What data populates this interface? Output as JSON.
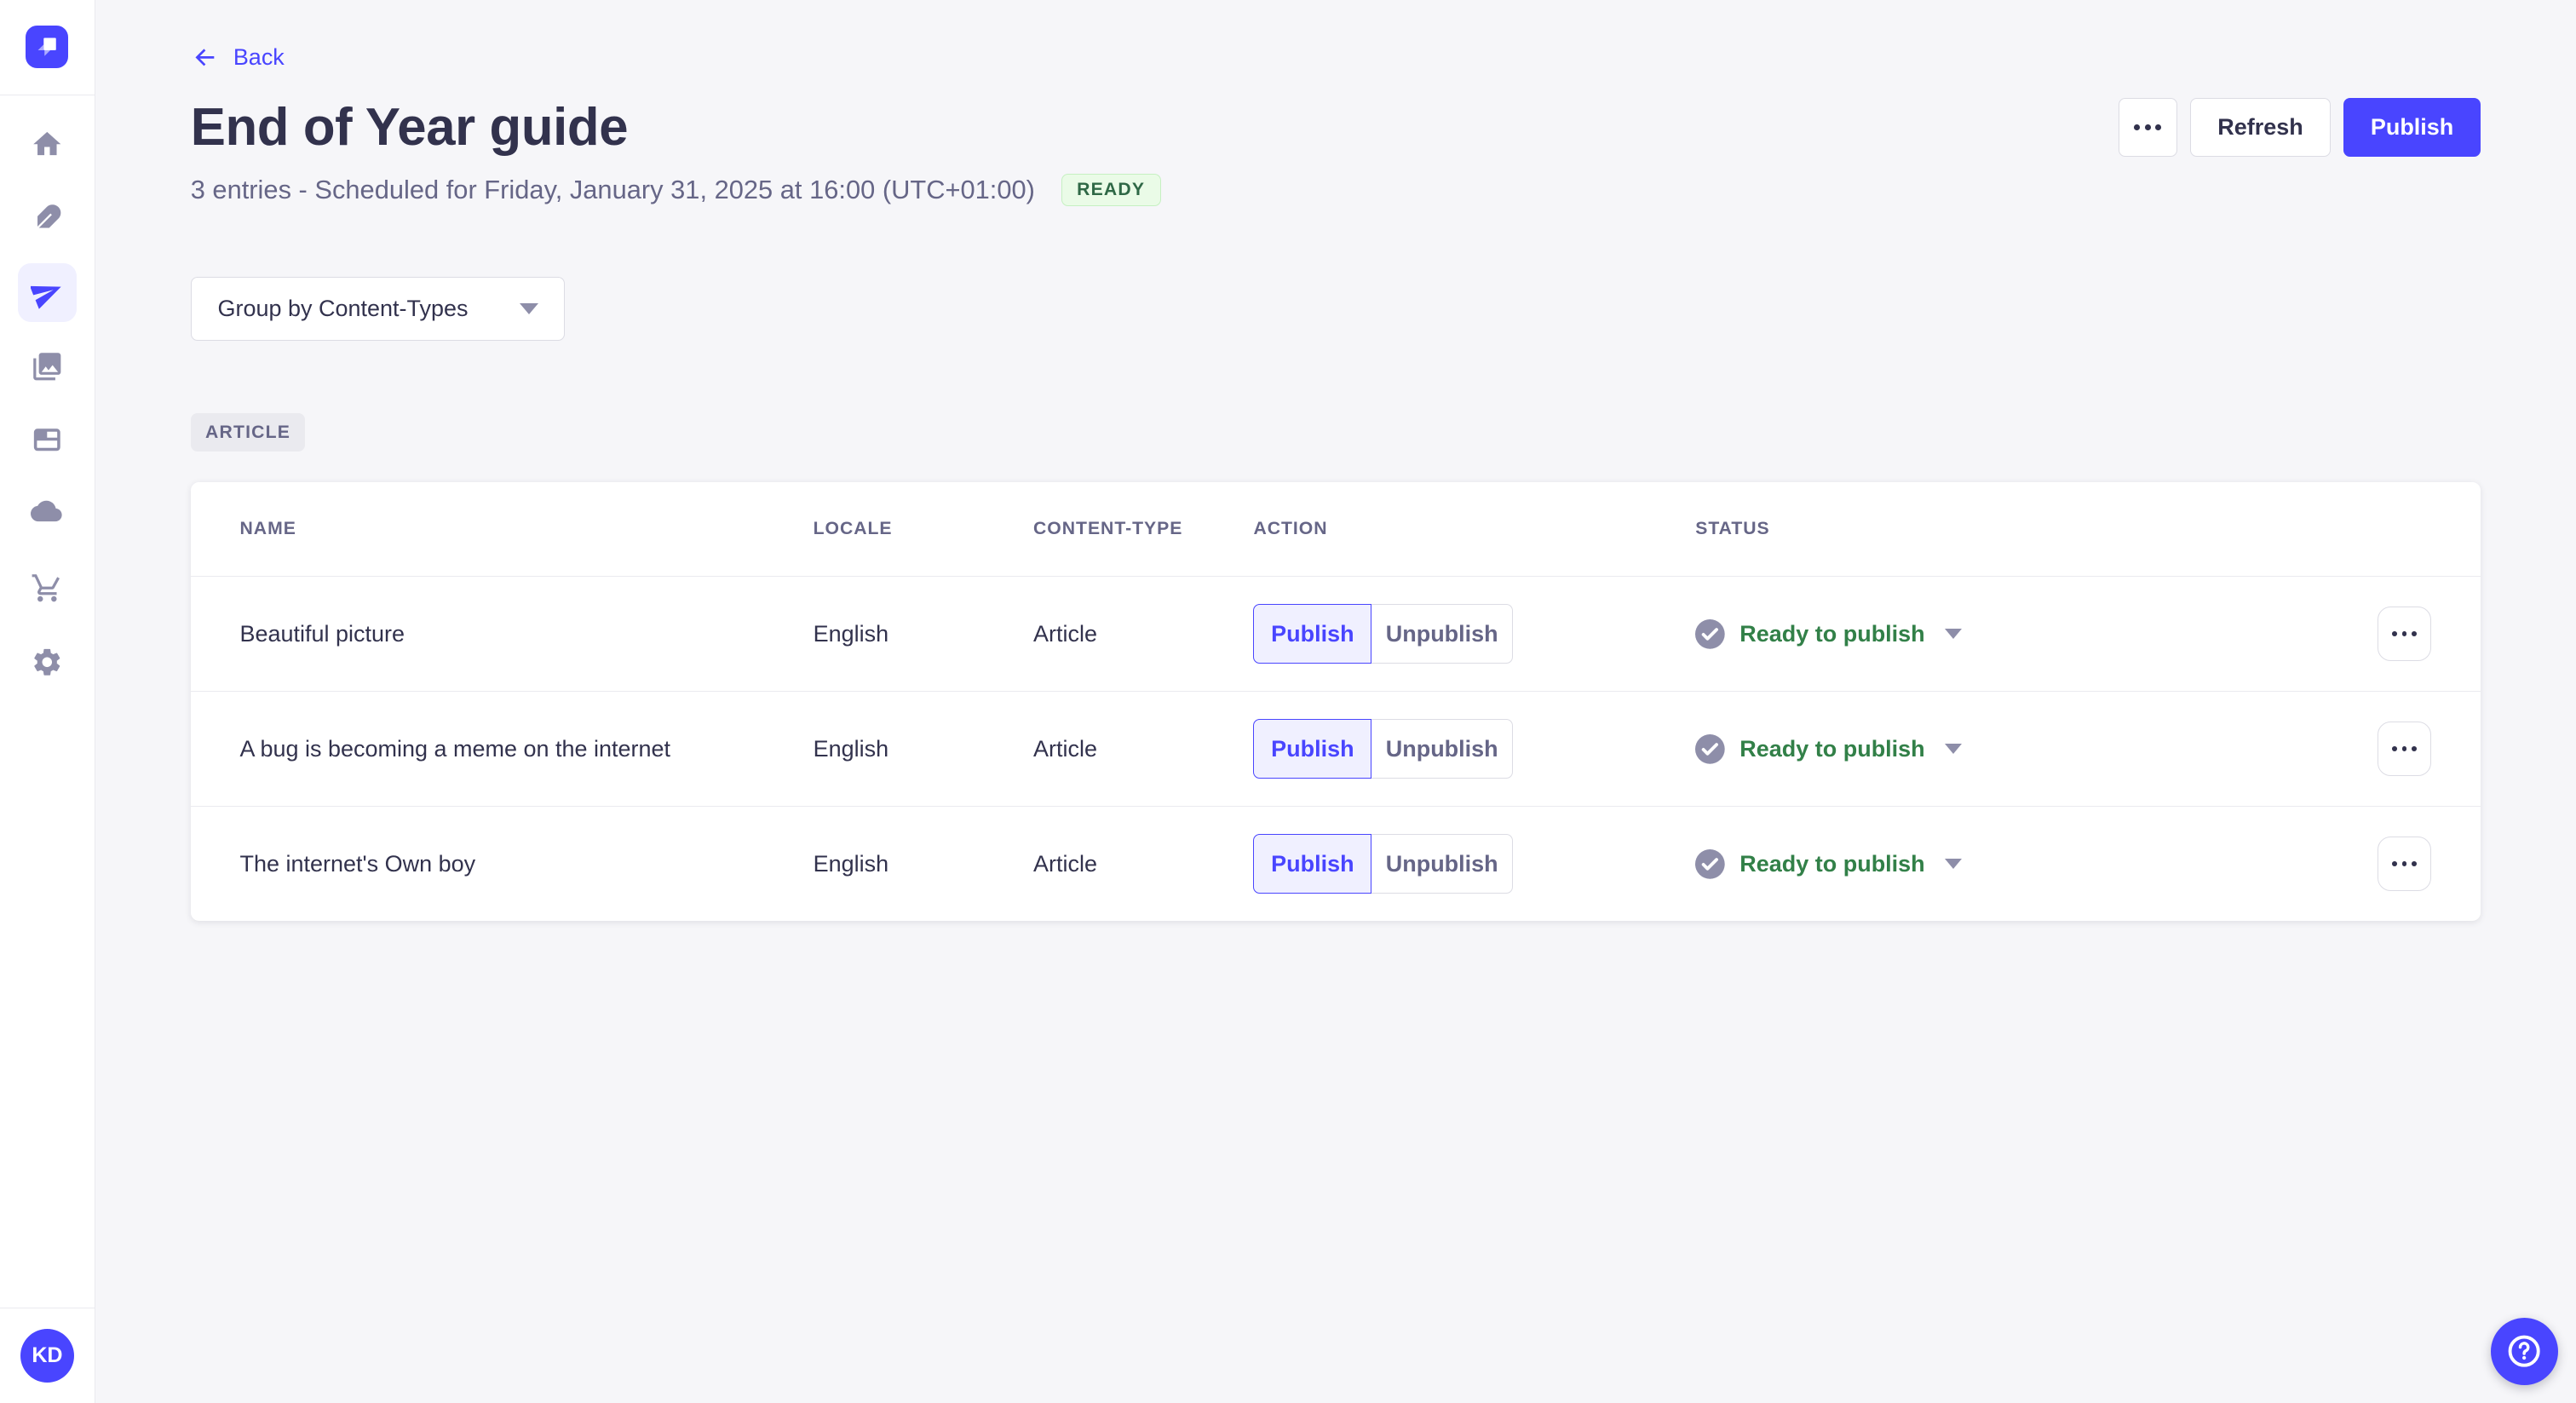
{
  "colors": {
    "accent": "#4945ff",
    "accent_light_bg": "#f0f0ff",
    "page_bg": "#f6f6f9",
    "border": "#dcdce4",
    "divider": "#eaeaef",
    "title_text": "#32324d",
    "subtle_text": "#666687",
    "icon_gray": "#8e8ea9",
    "ready_badge_bg": "#eafbe7",
    "ready_badge_border": "#c6f0c2",
    "ready_badge_text": "#2f6846",
    "status_green": "#328048"
  },
  "sidebar": {
    "logo_icon": "strapi-logo",
    "items": [
      {
        "icon": "home-icon",
        "active": false
      },
      {
        "icon": "feather-icon",
        "active": false
      },
      {
        "icon": "paper-plane-icon",
        "active": true
      },
      {
        "icon": "media-library-icon",
        "active": false
      },
      {
        "icon": "layout-icon",
        "active": false
      },
      {
        "icon": "cloud-icon",
        "active": false
      },
      {
        "icon": "cart-icon",
        "active": false
      },
      {
        "icon": "gear-icon",
        "active": false
      }
    ],
    "avatar_initials": "KD"
  },
  "header": {
    "back_label": "Back",
    "title": "End of Year guide",
    "subtitle": "3 entries - Scheduled for Friday, January 31, 2025 at 16:00 (UTC+01:00)",
    "release_status": "READY",
    "refresh_label": "Refresh",
    "publish_label": "Publish"
  },
  "toolbar": {
    "group_by_label": "Group by Content-Types"
  },
  "group": {
    "badge": "ARTICLE"
  },
  "table": {
    "headers": [
      "NAME",
      "LOCALE",
      "CONTENT-TYPE",
      "ACTION",
      "STATUS"
    ],
    "actions": {
      "publish": "Publish",
      "unpublish": "Unpublish"
    },
    "rows": [
      {
        "name": "Beautiful picture",
        "locale": "English",
        "content_type": "Article",
        "status": "Ready to publish"
      },
      {
        "name": "A bug is becoming a meme on the internet",
        "locale": "English",
        "content_type": "Article",
        "status": "Ready to publish"
      },
      {
        "name": "The internet's Own boy",
        "locale": "English",
        "content_type": "Article",
        "status": "Ready to publish"
      }
    ]
  }
}
